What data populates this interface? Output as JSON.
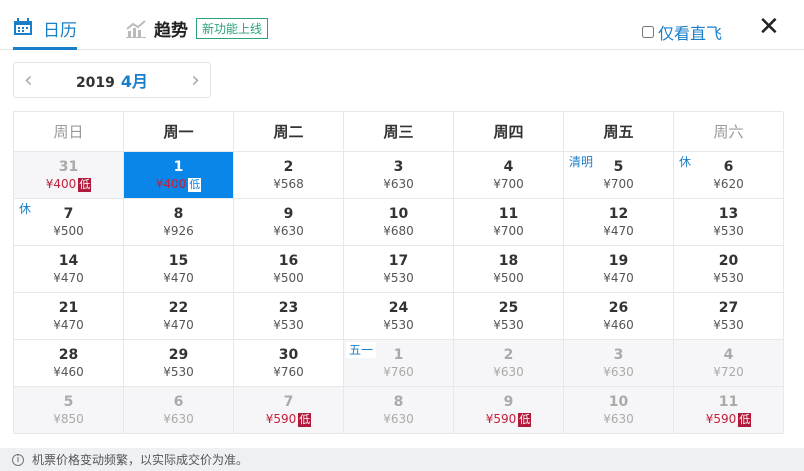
{
  "tabs": {
    "calendar": "日历",
    "trend": "趋势",
    "trend_badge": "新功能上线"
  },
  "direct_only": {
    "label": "仅看直飞",
    "checked": false
  },
  "month_nav": {
    "year": "2019",
    "month": "4月"
  },
  "weekdays": [
    "周日",
    "周一",
    "周二",
    "周三",
    "周四",
    "周五",
    "周六"
  ],
  "low_label": "低",
  "cells": [
    {
      "day": "31",
      "price": "¥400",
      "low": true,
      "muted": true
    },
    {
      "day": "1",
      "price": "¥400",
      "low": true,
      "selected": true
    },
    {
      "day": "2",
      "price": "¥568"
    },
    {
      "day": "3",
      "price": "¥630"
    },
    {
      "day": "4",
      "price": "¥700"
    },
    {
      "day": "5",
      "price": "¥700",
      "tag": "清明"
    },
    {
      "day": "6",
      "price": "¥620",
      "tag": "休"
    },
    {
      "day": "7",
      "price": "¥500",
      "tag": "休"
    },
    {
      "day": "8",
      "price": "¥926"
    },
    {
      "day": "9",
      "price": "¥630"
    },
    {
      "day": "10",
      "price": "¥680"
    },
    {
      "day": "11",
      "price": "¥700"
    },
    {
      "day": "12",
      "price": "¥470"
    },
    {
      "day": "13",
      "price": "¥530"
    },
    {
      "day": "14",
      "price": "¥470"
    },
    {
      "day": "15",
      "price": "¥470"
    },
    {
      "day": "16",
      "price": "¥500"
    },
    {
      "day": "17",
      "price": "¥530"
    },
    {
      "day": "18",
      "price": "¥500"
    },
    {
      "day": "19",
      "price": "¥470"
    },
    {
      "day": "20",
      "price": "¥530"
    },
    {
      "day": "21",
      "price": "¥470"
    },
    {
      "day": "22",
      "price": "¥470"
    },
    {
      "day": "23",
      "price": "¥530"
    },
    {
      "day": "24",
      "price": "¥530"
    },
    {
      "day": "25",
      "price": "¥530"
    },
    {
      "day": "26",
      "price": "¥460"
    },
    {
      "day": "27",
      "price": "¥530"
    },
    {
      "day": "28",
      "price": "¥460"
    },
    {
      "day": "29",
      "price": "¥530"
    },
    {
      "day": "30",
      "price": "¥760"
    },
    {
      "day": "1",
      "price": "¥760",
      "muted": true,
      "tag": "五一"
    },
    {
      "day": "2",
      "price": "¥630",
      "muted": true
    },
    {
      "day": "3",
      "price": "¥630",
      "muted": true
    },
    {
      "day": "4",
      "price": "¥720",
      "muted": true
    },
    {
      "day": "5",
      "price": "¥850",
      "muted": true
    },
    {
      "day": "6",
      "price": "¥630",
      "muted": true
    },
    {
      "day": "7",
      "price": "¥590",
      "muted": true,
      "low": true
    },
    {
      "day": "8",
      "price": "¥630",
      "muted": true
    },
    {
      "day": "9",
      "price": "¥590",
      "muted": true,
      "low": true
    },
    {
      "day": "10",
      "price": "¥630",
      "muted": true
    },
    {
      "day": "11",
      "price": "¥590",
      "muted": true,
      "low": true
    }
  ],
  "footer": "机票价格变动频繁，以实际成交价为准。"
}
